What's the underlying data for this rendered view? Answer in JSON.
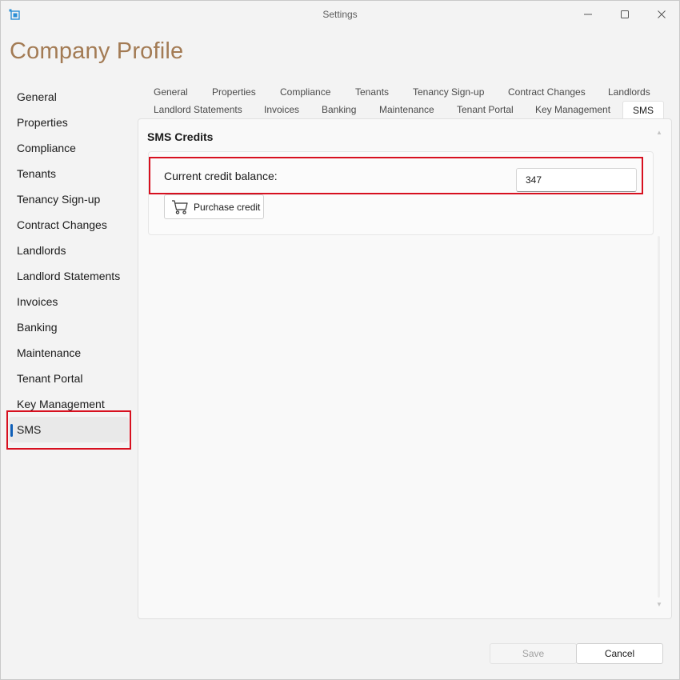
{
  "window": {
    "title": "Settings",
    "icon": "app-settings-icon"
  },
  "page": {
    "heading": "Company Profile",
    "accent_color": "#a37b54"
  },
  "sidebar": {
    "items": [
      {
        "label": "General"
      },
      {
        "label": "Properties"
      },
      {
        "label": "Compliance"
      },
      {
        "label": "Tenants"
      },
      {
        "label": "Tenancy Sign-up"
      },
      {
        "label": "Contract Changes"
      },
      {
        "label": "Landlords"
      },
      {
        "label": "Landlord Statements"
      },
      {
        "label": "Invoices"
      },
      {
        "label": "Banking"
      },
      {
        "label": "Maintenance"
      },
      {
        "label": "Tenant Portal"
      },
      {
        "label": "Key Management"
      },
      {
        "label": "SMS"
      }
    ],
    "selected": "SMS",
    "selected_indicator_color": "#0f5fb8"
  },
  "tabs": {
    "row1": [
      {
        "label": "General"
      },
      {
        "label": "Properties"
      },
      {
        "label": "Compliance"
      },
      {
        "label": "Tenants"
      },
      {
        "label": "Tenancy Sign-up"
      },
      {
        "label": "Contract Changes"
      },
      {
        "label": "Landlords"
      }
    ],
    "row2": [
      {
        "label": "Landlord Statements"
      },
      {
        "label": "Invoices"
      },
      {
        "label": "Banking"
      },
      {
        "label": "Maintenance"
      },
      {
        "label": "Tenant Portal"
      },
      {
        "label": "Key Management"
      },
      {
        "label": "SMS"
      }
    ],
    "active": "SMS"
  },
  "sms": {
    "section_title": "SMS Credits",
    "credit_label": "Current credit balance:",
    "credit_value": "347",
    "purchase_label": "Purchase credit",
    "purchase_icon": "shopping-cart-icon"
  },
  "footer": {
    "save_label": "Save",
    "cancel_label": "Cancel"
  },
  "annotation_color": "#d7101f"
}
